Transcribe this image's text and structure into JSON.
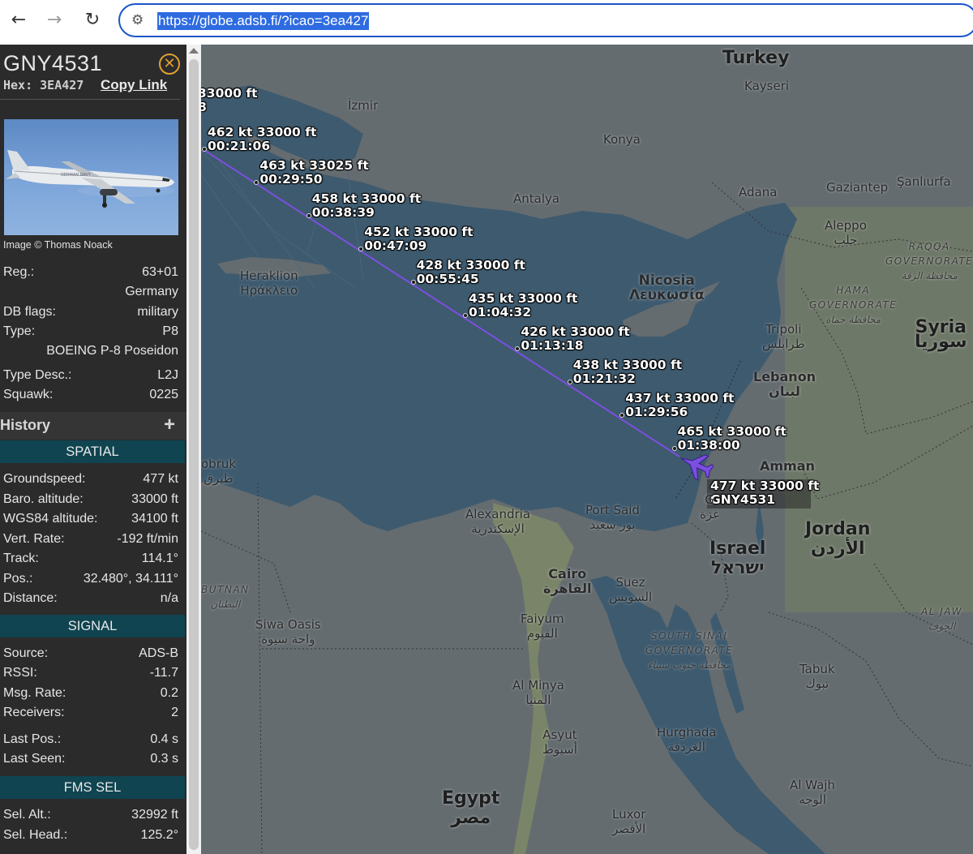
{
  "browser": {
    "back_icon": "arrow-left-icon",
    "forward_icon": "arrow-right-icon",
    "reload_icon": "reload-icon",
    "url": "https://globe.adsb.fi/?icao=3ea427"
  },
  "aircraft": {
    "callsign": "GNY4531",
    "hex_label": "Hex:",
    "hex": "3EA427",
    "copy_link": "Copy Link",
    "image_credit": "Image © Thomas Noack",
    "reg_label": "Reg.:",
    "reg": "63+01",
    "country": "Germany",
    "db_flags_label": "DB flags:",
    "db_flags": "military",
    "type_label": "Type:",
    "type": "P8",
    "type_name": "BOEING P-8 Poseidon",
    "type_desc_label": "Type Desc.:",
    "type_desc": "L2J",
    "squawk_label": "Squawk:",
    "squawk": "0225"
  },
  "history": {
    "label": "History",
    "plus": "+"
  },
  "spatial": {
    "header": "SPATIAL",
    "rows": [
      {
        "label": "Groundspeed:",
        "value": "477 kt"
      },
      {
        "label": "Baro. altitude:",
        "value": "33000 ft"
      },
      {
        "label": "WGS84 altitude:",
        "value": "34100 ft"
      },
      {
        "label": "Vert. Rate:",
        "value": "-192 ft/min"
      },
      {
        "label": "Track:",
        "value": "114.1°"
      },
      {
        "label": "Pos.:",
        "value": "32.480°, 34.111°"
      },
      {
        "label": "Distance:",
        "value": "n/a"
      }
    ]
  },
  "signal": {
    "header": "SIGNAL",
    "rows": [
      {
        "label": "Source:",
        "value": "ADS-B"
      },
      {
        "label": "RSSI:",
        "value": "-11.7"
      },
      {
        "label": "Msg. Rate:",
        "value": "0.2"
      },
      {
        "label": "Receivers:",
        "value": "2"
      },
      {
        "label": "Last Pos.:",
        "value": "0.4 s"
      },
      {
        "label": "Last Seen:",
        "value": "0.3 s"
      }
    ]
  },
  "fms": {
    "header": "FMS SEL",
    "rows": [
      {
        "label": "Sel. Alt.:",
        "value": "32992 ft"
      },
      {
        "label": "Sel. Head.:",
        "value": "125.2°"
      }
    ]
  },
  "map": {
    "labels": {
      "turkey": "Turkey",
      "kayseri": "Kayseri",
      "izmir": "İzmir",
      "konya": "Konya",
      "antalya": "Antalya",
      "adana": "Adana",
      "gaziantep": "Gaziantep",
      "sanliurfa": "Şanlıurfa",
      "aleppo": "Aleppo",
      "aleppo_ar": "حلب",
      "raqqa": "RAQQA",
      "raqqa2": "GOVERNORATE",
      "raqqa_ar": "محافظة الرقة",
      "hama": "HAMA",
      "hama2": "GOVERNORATE",
      "hama_ar": "محافظة حماة",
      "nicosia": "Nicosia",
      "nicosia_gr": "Λευκωσία",
      "heraklion": "Heraklion",
      "heraklion_gr": "Ηράκλειο",
      "tripoli": "Tripoli",
      "tripoli_ar": "طرابلس",
      "syria": "Syria",
      "syria_ar": "سوريا",
      "lebanon": "Lebanon",
      "lebanon_ar": "لبنان",
      "amman": "Amman",
      "tobruk": "obruk",
      "tobruk_ar": "طبرق",
      "alexandria": "Alexandria",
      "alexandria_ar": "الإسكندرية",
      "port_said": "Port Said",
      "port_said_ar": "بور سعيد",
      "israel": "Israel",
      "israel_he": "ישראל",
      "jordan": "Jordan",
      "jordan_ar": "الأردن",
      "cairo": "Cairo",
      "cairo_ar": "القاهرة",
      "suez": "Suez",
      "suez_ar": "السويس",
      "butnan": "BUTNAN",
      "butnan_ar": "البطنان",
      "siwa": "Siwa Oasis",
      "siwa_ar": "واحة سيوة",
      "faiyum": "Faiyum",
      "faiyum_ar": "الفيوم",
      "south_sinai": "SOUTH SINAI",
      "south_sinai2": "GOVERNORATE",
      "south_sinai_ar": "محافظة جنوب سيناء",
      "al_jaw": "AL JAW",
      "al_jaw_ar": "الجوف",
      "al_minya": "Al Minya",
      "al_minya_ar": "المنيا",
      "tabuk": "Tabuk",
      "tabuk_ar": "تبوك",
      "asyut": "Asyut",
      "asyut_ar": "أسيوط",
      "hurghada": "Hurghada",
      "hurghada_ar": "الغردقة",
      "al_wajh": "Al Wajh",
      "al_wajh_ar": "الوجه",
      "egypt": "Egypt",
      "egypt_ar": "مصر",
      "luxor": "Luxor",
      "luxor_ar": "الأقصر",
      "gaza": "G",
      "gaza_ar": "غزة"
    },
    "track_points": [
      {
        "speed": "",
        "alt": "33000 ft",
        "time": "8"
      },
      {
        "speed": "462 kt",
        "alt": "33000 ft",
        "time": "00:21:06"
      },
      {
        "speed": "463 kt",
        "alt": "33025 ft",
        "time": "00:29:50"
      },
      {
        "speed": "458 kt",
        "alt": "33000 ft",
        "time": "00:38:39"
      },
      {
        "speed": "452 kt",
        "alt": "33000 ft",
        "time": "00:47:09"
      },
      {
        "speed": "428 kt",
        "alt": "33000 ft",
        "time": "00:55:45"
      },
      {
        "speed": "435 kt",
        "alt": "33000 ft",
        "time": "01:04:32"
      },
      {
        "speed": "426 kt",
        "alt": "33000 ft",
        "time": "01:13:18"
      },
      {
        "speed": "438 kt",
        "alt": "33000 ft",
        "time": "01:21:32"
      },
      {
        "speed": "437 kt",
        "alt": "33000 ft",
        "time": "01:29:56"
      },
      {
        "speed": "465 kt",
        "alt": "33000 ft",
        "time": "01:38:00"
      }
    ],
    "plane": {
      "speed": "477 kt",
      "alt": "33000 ft",
      "callsign": "GNY4531"
    },
    "colors": {
      "sea": "#3e5a6e",
      "land": "#5f6a70",
      "track": "#7b4fe0",
      "plane": "#7b4fe0"
    }
  }
}
